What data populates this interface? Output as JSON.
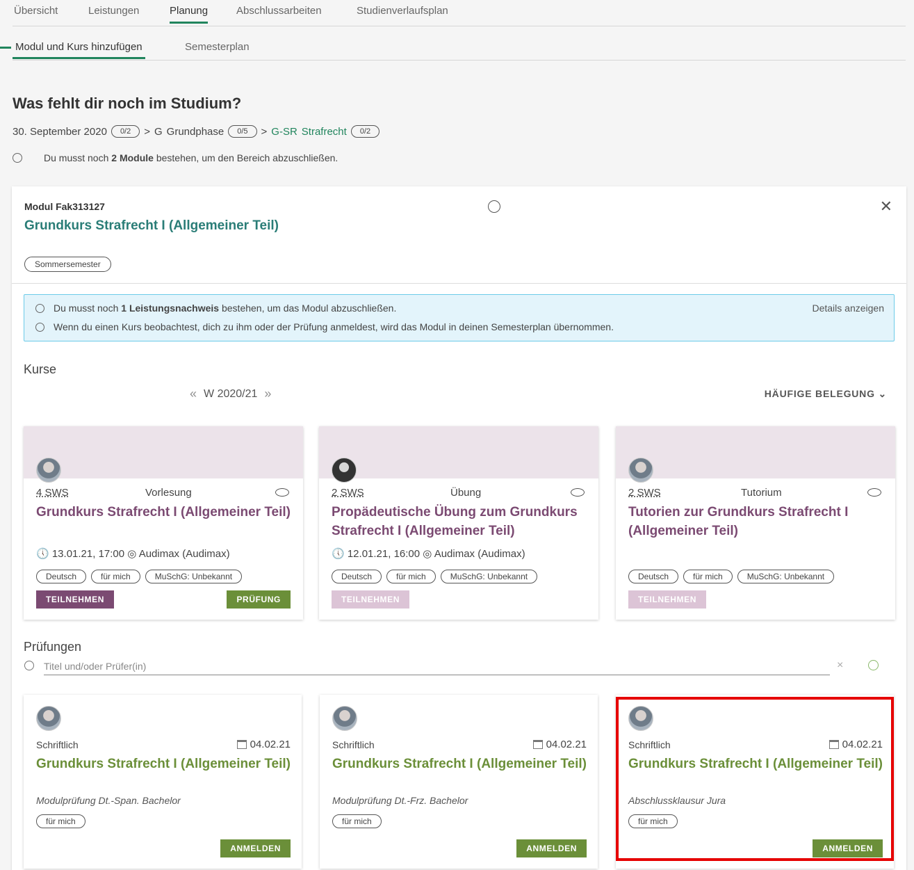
{
  "tabs": [
    "Übersicht",
    "Leistungen",
    "Planung",
    "Abschlussarbeiten",
    "Studienverlaufsplan"
  ],
  "subtabs": [
    "Modul und Kurs hinzufügen",
    "Semesterplan"
  ],
  "heading": "Was fehlt dir noch im Studium?",
  "breadcrumb": {
    "date": "30. September 2020",
    "date_count": "0/2",
    "g_code": "G",
    "g_name": "Grundphase",
    "g_count": "0/5",
    "sr_code": "G-SR",
    "sr_name": "Strafrecht",
    "sr_count": "0/2"
  },
  "area_info": {
    "prefix": "Du musst noch",
    "bold": "2 Module",
    "suffix": "bestehen, um den Bereich abzuschließen."
  },
  "module": {
    "code": "Modul Fak313127",
    "title": "Grundkurs Strafrecht I (Allgemeiner Teil)",
    "season": "Sommersemester",
    "notice1_prefix": "Du musst noch",
    "notice1_bold": "1 Leistungsnachweis",
    "notice1_suffix": "bestehen, um das Modul abzuschließen.",
    "notice2": "Wenn du einen Kurs beobachtest, dich zu ihm oder der Prüfung anmeldest, wird das Modul in deinen Semesterplan übernommen.",
    "details": "Details anzeigen"
  },
  "kurse": {
    "label": "Kurse",
    "semester": "W 2020/21",
    "prev": "«",
    "next": "»",
    "sort": "HÄUFIGE BELEGUNG ⌄",
    "items": [
      {
        "sws": "4 SWS",
        "type": "Vorlesung",
        "title": "Grundkurs Strafrecht I (Allgemeiner Teil)",
        "when": "🕔 13.01.21, 17:00  ◎ Audimax (Audimax)",
        "tags": [
          "Deutsch",
          "für mich",
          "MuSchG: Unbekannt"
        ],
        "join": "TEILNEHMEN",
        "exam": "PRÜFUNG"
      },
      {
        "sws": "2 SWS",
        "type": "Übung",
        "title": "Propädeutische Übung zum Grundkurs Strafrecht I (Allgemeiner Teil)",
        "when": "🕔 12.01.21, 16:00  ◎ Audimax (Audimax)",
        "tags": [
          "Deutsch",
          "für mich",
          "MuSchG: Unbekannt"
        ],
        "join": "TEILNEHMEN"
      },
      {
        "sws": "2 SWS",
        "type": "Tutorium",
        "title": "Tutorien zur Grundkurs Strafrecht I (Allgemeiner Teil)",
        "when": "",
        "tags": [
          "Deutsch",
          "für mich",
          "MuSchG: Unbekannt"
        ],
        "join": "TEILNEHMEN"
      }
    ]
  },
  "pruefungen": {
    "label": "Prüfungen",
    "search_placeholder": "Titel und/oder Prüfer(in)",
    "clear": "×",
    "items": [
      {
        "kind": "Schriftlich",
        "date": "04.02.21",
        "title": "Grundkurs Strafrecht I (Allgemeiner Teil)",
        "sub": "Modulprüfung Dt.-Span. Bachelor",
        "tag": "für mich",
        "button": "ANMELDEN"
      },
      {
        "kind": "Schriftlich",
        "date": "04.02.21",
        "title": "Grundkurs Strafrecht I (Allgemeiner Teil)",
        "sub": "Modulprüfung Dt.-Frz. Bachelor",
        "tag": "für mich",
        "button": "ANMELDEN"
      },
      {
        "kind": "Schriftlich",
        "date": "04.02.21",
        "title": "Grundkurs Strafrecht I (Allgemeiner Teil)",
        "sub": "Abschlussklausur Jura",
        "tag": "für mich",
        "button": "ANMELDEN"
      }
    ]
  },
  "colors": {
    "accent": "#21855d",
    "course_title": "#7b4a72",
    "exam_green": "#6b8f39",
    "highlight": "#e60000"
  }
}
